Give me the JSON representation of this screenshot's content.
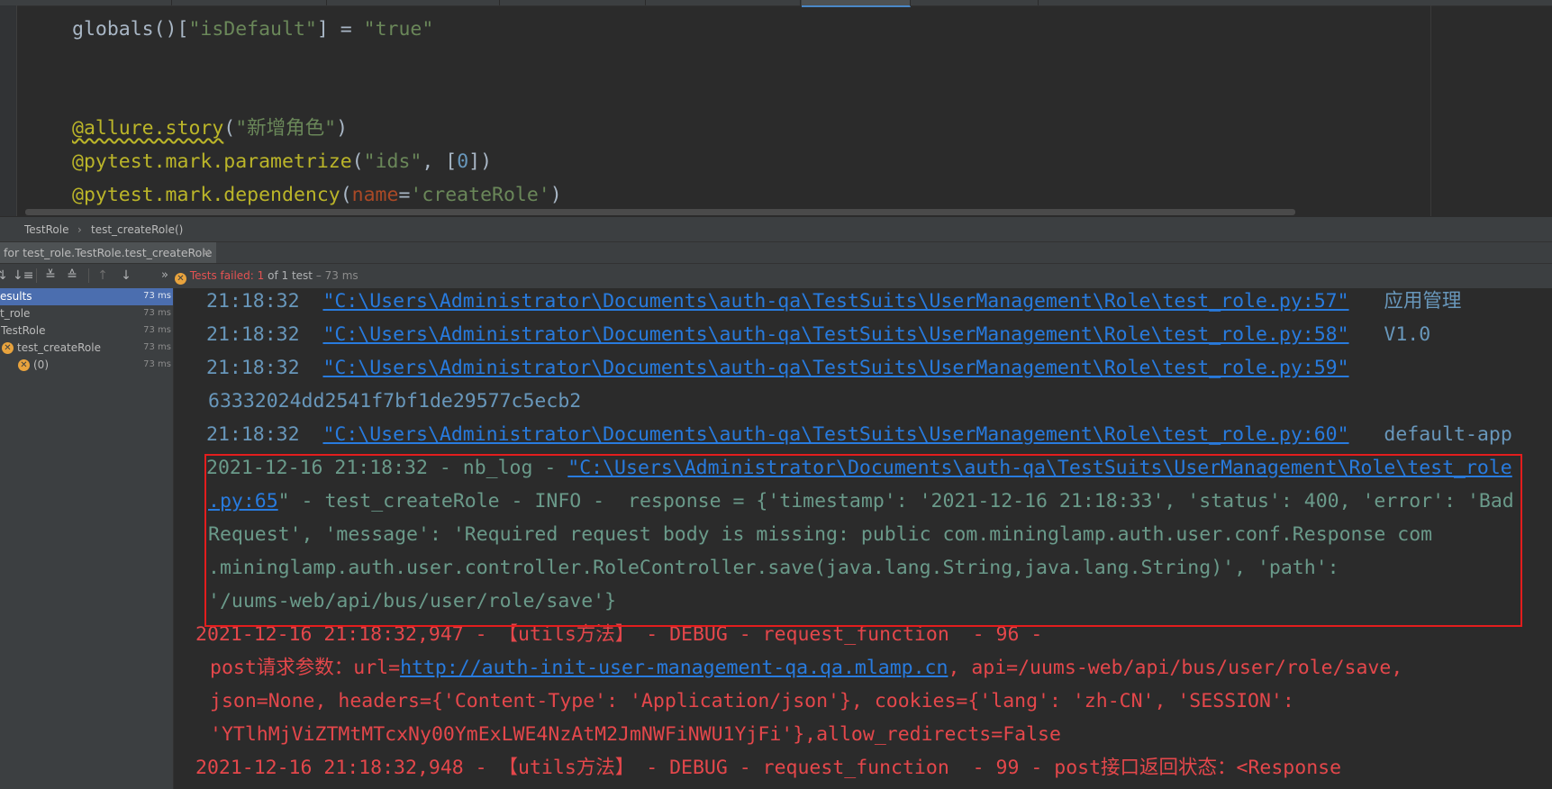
{
  "editor": {
    "lines": [
      {
        "fn": "globals()[",
        "key": "\"isDefault\"",
        "eq": "] = ",
        "val": "\"true\""
      },
      {
        "deco": "@allure.story",
        "p1": "(",
        "arg": "\"新增角色\"",
        "p2": ")"
      },
      {
        "deco": "@pytest.mark.parametrize",
        "p1": "(",
        "arg": "\"ids\"",
        "mid": ", [",
        "num": "0",
        "p2": "])"
      },
      {
        "deco": "@pytest.mark.dependency",
        "p1": "(",
        "kw": "name",
        "eq": "=",
        "arg": "'createRole'",
        "p2": ")"
      }
    ]
  },
  "breadcrumb": {
    "class_name": "TestRole",
    "separator": "›",
    "method": "test_createRole()"
  },
  "run_tab": {
    "label": "for test_role.TestRole.test_createRole",
    "close": "×"
  },
  "toolbar": {
    "status_prefix": "Tests failed:",
    "status_count": "1",
    "status_suffix": "of 1 test",
    "status_time": "– 73 ms"
  },
  "tree": {
    "items": [
      {
        "label": "esults",
        "time": "73 ms",
        "selected": true
      },
      {
        "label": "t_role",
        "time": "73 ms"
      },
      {
        "label": "TestRole",
        "time": "73 ms"
      },
      {
        "label": "test_createRole",
        "time": "73 ms",
        "failed": true
      },
      {
        "label": "(0)",
        "time": "73 ms",
        "failed": true
      }
    ]
  },
  "console": {
    "lines": {
      "l1": {
        "time": "21:18:32",
        "link": "\"C:\\Users\\Administrator\\Documents\\auth-qa\\TestSuits\\UserManagement\\Role\\test_role.py:57\"",
        "msg": "应用管理"
      },
      "l2": {
        "time": "21:18:32",
        "link": "\"C:\\Users\\Administrator\\Documents\\auth-qa\\TestSuits\\UserManagement\\Role\\test_role.py:58\"",
        "msg": "V1.0"
      },
      "l3": {
        "time": "21:18:32",
        "link": "\"C:\\Users\\Administrator\\Documents\\auth-qa\\TestSuits\\UserManagement\\Role\\test_role.py:59\""
      },
      "l4": {
        "text": "63332024dd2541f7bf1de29577c5ecb2"
      },
      "l5": {
        "time": "21:18:32",
        "link": "\"C:\\Users\\Administrator\\Documents\\auth-qa\\TestSuits\\UserManagement\\Role\\test_role.py:60\"",
        "msg": "default-app"
      },
      "l6": {
        "prefix": "2021-12-16 21:18:32 - nb_log - ",
        "link": "\"C:\\Users\\Administrator\\Documents\\auth-qa\\TestSuits\\UserManagement\\Role\\test_role"
      },
      "l7": {
        "link": ".py:65",
        "rest": "\" - test_createRole - INFO -  response = {'timestamp': '2021-12-16 21:18:33', 'status': 400, 'error': 'Bad"
      },
      "l8": {
        "text": "Request', 'message': 'Required request body is missing: public com.mininglamp.auth.user.conf.Response com"
      },
      "l9": {
        "text": ".mininglamp.auth.user.controller.RoleController.save(java.lang.String,java.lang.String)', 'path':"
      },
      "l10": {
        "text": "'/uums-web/api/bus/user/role/save'}"
      },
      "l11": {
        "text": "2021-12-16 21:18:32,947 - 【utils方法】 - DEBUG - request_function  - 96 -"
      },
      "l12": {
        "prefix": "post请求参数：url=",
        "link": "http://auth-init-user-management-qa.qa.mlamp.cn",
        "rest": ", api=/uums-web/api/bus/user/role/save,"
      },
      "l13": {
        "text": "json=None, headers={'Content-Type': 'Application/json'}, cookies={'lang': 'zh-CN', 'SESSION':"
      },
      "l14": {
        "text": "'YTlhMjViZTMtMTcxNy00YmExLWE4NzAtM2JmNWFiNWU1YjFi'},allow_redirects=False"
      },
      "l15": {
        "text": "2021-12-16 21:18:32,948 - 【utils方法】 - DEBUG - request_function  - 99 - post接口返回状态：<Response"
      }
    }
  },
  "colors": {
    "highlight_border": "#e31d1d",
    "selection": "#4b6eaf",
    "fail": "#e35252",
    "warn_icon": "#e8a33d"
  }
}
